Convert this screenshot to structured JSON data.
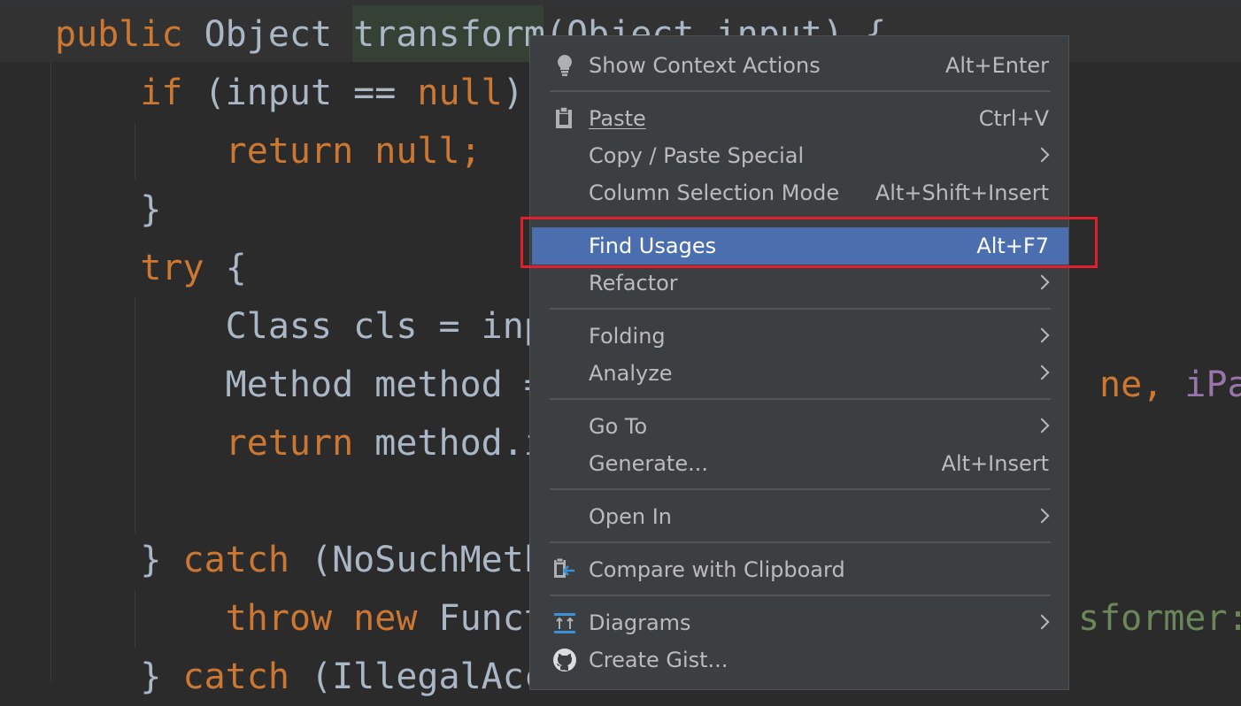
{
  "code": {
    "lines": [
      {
        "tokens": [
          {
            "t": "public ",
            "c": "kw"
          },
          {
            "t": "Object ",
            "c": "pl"
          },
          {
            "t": "transform",
            "c": "pl"
          },
          {
            "t": "(Object input) {",
            "c": "pl"
          }
        ]
      },
      {
        "tokens": [
          {
            "t": "    if ",
            "c": "kw"
          },
          {
            "t": "(input == ",
            "c": "pl"
          },
          {
            "t": "null",
            "c": "kw"
          },
          {
            "t": ")",
            "c": "pl"
          }
        ]
      },
      {
        "tokens": [
          {
            "t": "        return ",
            "c": "kw"
          },
          {
            "t": "null",
            "c": "kw"
          },
          {
            "t": ";",
            "c": "kw"
          }
        ]
      },
      {
        "tokens": [
          {
            "t": "    }",
            "c": "pl"
          }
        ]
      },
      {
        "tokens": [
          {
            "t": "    try ",
            "c": "kw"
          },
          {
            "t": "{",
            "c": "pl"
          }
        ]
      },
      {
        "tokens": [
          {
            "t": "        Class cls = inp",
            "c": "pl"
          }
        ]
      },
      {
        "tokens": [
          {
            "t": "        Method method = ",
            "c": "pl"
          },
          {
            "t": "                         ",
            "c": "pl"
          },
          {
            "t": "ne, ",
            "c": "kw"
          },
          {
            "t": "iPara",
            "c": "pu"
          }
        ]
      },
      {
        "tokens": [
          {
            "t": "        return ",
            "c": "kw"
          },
          {
            "t": "method.i",
            "c": "pl"
          }
        ]
      },
      {
        "tokens": [
          {
            "t": "",
            "c": "pl"
          }
        ]
      },
      {
        "tokens": [
          {
            "t": "    } ",
            "c": "pl"
          },
          {
            "t": "catch ",
            "c": "kw"
          },
          {
            "t": "(NoSuchMeth",
            "c": "pl"
          }
        ]
      },
      {
        "tokens": [
          {
            "t": "        throw new ",
            "c": "kw"
          },
          {
            "t": "Funct",
            "c": "pl"
          },
          {
            "t": "                         ",
            "c": "pl"
          },
          {
            "t": "sformer: ",
            "c": "gr"
          }
        ]
      },
      {
        "tokens": [
          {
            "t": "    } ",
            "c": "pl"
          },
          {
            "t": "catch ",
            "c": "kw"
          },
          {
            "t": "(IllegalAcc",
            "c": "pl"
          }
        ]
      }
    ]
  },
  "menu": {
    "items": [
      {
        "name": "show-context-actions",
        "label": "Show Context Actions",
        "shortcut": "Alt+Enter",
        "icon": "lightbulb-icon"
      },
      {
        "name": "paste",
        "label": "Paste",
        "shortcut": "Ctrl+V",
        "icon": "clipboard-icon"
      },
      {
        "name": "copy-paste-special",
        "label": "Copy / Paste Special",
        "submenu": true
      },
      {
        "name": "column-selection-mode",
        "label": "Column Selection Mode",
        "shortcut": "Alt+Shift+Insert"
      },
      {
        "name": "find-usages",
        "label": "Find Usages",
        "shortcut": "Alt+F7",
        "selected": true
      },
      {
        "name": "refactor",
        "label": "Refactor",
        "submenu": true
      },
      {
        "name": "folding",
        "label": "Folding",
        "submenu": true
      },
      {
        "name": "analyze",
        "label": "Analyze",
        "submenu": true
      },
      {
        "name": "go-to",
        "label": "Go To",
        "submenu": true
      },
      {
        "name": "generate",
        "label": "Generate...",
        "shortcut": "Alt+Insert"
      },
      {
        "name": "open-in",
        "label": "Open In",
        "submenu": true
      },
      {
        "name": "compare-with-clipboard",
        "label": "Compare with Clipboard",
        "icon": "compare-icon"
      },
      {
        "name": "diagrams",
        "label": "Diagrams",
        "submenu": true,
        "icon": "diagram-icon"
      },
      {
        "name": "create-gist",
        "label": "Create Gist...",
        "icon": "github-icon"
      }
    ]
  },
  "colors": {
    "selection": "#4b6eaf",
    "highlight_box": "#e0202c",
    "menu_bg": "#3c3f41",
    "editor_bg": "#2b2b2b"
  }
}
